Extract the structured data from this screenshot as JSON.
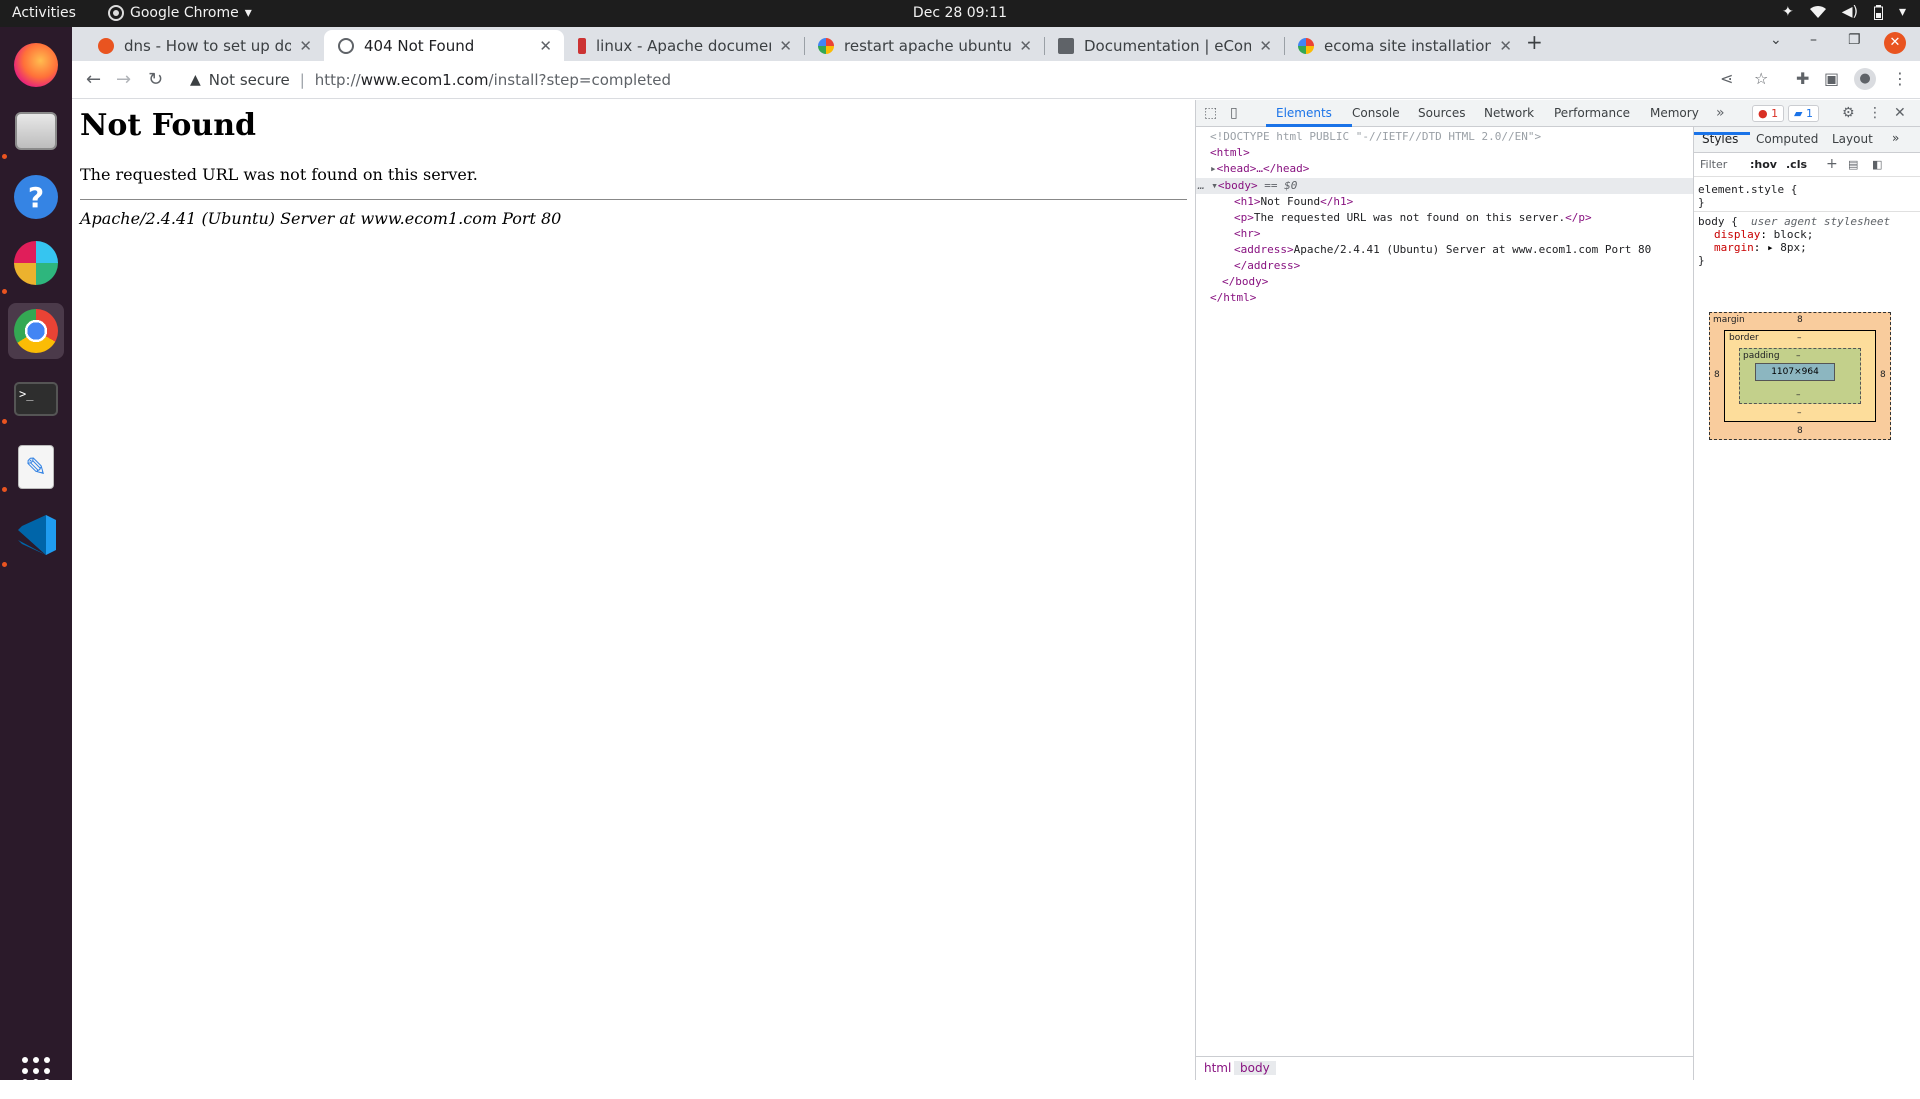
{
  "topbar": {
    "activities": "Activities",
    "app_name": "Google Chrome",
    "clock": "Dec 28  09:11"
  },
  "dock": {
    "items": [
      "firefox-icon",
      "files-icon",
      "help-icon",
      "slack-icon",
      "chrome-icon",
      "terminal-icon",
      "text-editor-icon",
      "vscode-icon",
      "app-grid-icon"
    ]
  },
  "tabs": [
    {
      "title": "dns - How to set up doma",
      "favicon": "askubuntu-icon"
    },
    {
      "title": "404 Not Found",
      "favicon": "globe-icon"
    },
    {
      "title": "linux - Apache document",
      "favicon": "serverfault-icon"
    },
    {
      "title": "restart apache ubuntu - G",
      "favicon": "google-icon"
    },
    {
      "title": "Documentation | eComme",
      "favicon": "docs-icon"
    },
    {
      "title": "ecoma site installation - G",
      "favicon": "google-icon"
    }
  ],
  "omnibox": {
    "security_label": "Not secure",
    "url_scheme": "http://",
    "url_host": "www.ecom1.com",
    "url_path": "/install?step=completed"
  },
  "page": {
    "heading": "Not Found",
    "message": "The requested URL was not found on this server.",
    "address": "Apache/2.4.41 (Ubuntu) Server at www.ecom1.com Port 80"
  },
  "devtools": {
    "tabs": [
      "Elements",
      "Console",
      "Sources",
      "Network",
      "Performance",
      "Memory"
    ],
    "error_count": "1",
    "message_count": "1",
    "dom": {
      "doctype": "<!DOCTYPE html PUBLIC \"-//IETF//DTD HTML 2.0//EN\">",
      "html_open": "<html>",
      "head": "<head>…</head>",
      "body_open": "<body>",
      "body_eq": " == $0",
      "h1_open": "<h1>",
      "h1_text": "Not Found",
      "h1_close": "</h1>",
      "p_open": "<p>",
      "p_text": "The requested URL was not found on this server.",
      "p_close": "</p>",
      "hr": "<hr>",
      "address_open": "<address>",
      "address_text": "Apache/2.4.41 (Ubuntu) Server at www.ecom1.com Port 80",
      "address_close": "</address>",
      "body_close": "</body>",
      "html_close": "</html>"
    },
    "breadcrumbs": [
      "html",
      "body"
    ],
    "styles": {
      "tabs": [
        "Styles",
        "Computed",
        "Layout"
      ],
      "filter_placeholder": "Filter",
      "hov": ":hov",
      "cls": ".cls",
      "element_style": "element.style {",
      "close_brace": "}",
      "body_selector": "body {",
      "body_source": "user agent stylesheet",
      "props": [
        {
          "name": "display",
          "value": "block;"
        },
        {
          "name": "margin",
          "value": "8px;"
        }
      ]
    },
    "box_model": {
      "margin_label": "margin",
      "border_label": "border",
      "padding_label": "padding",
      "margin_top": "8",
      "margin_bottom": "8",
      "margin_left": "8",
      "margin_right": "8",
      "dash": "–",
      "content_size": "1107×964"
    }
  }
}
